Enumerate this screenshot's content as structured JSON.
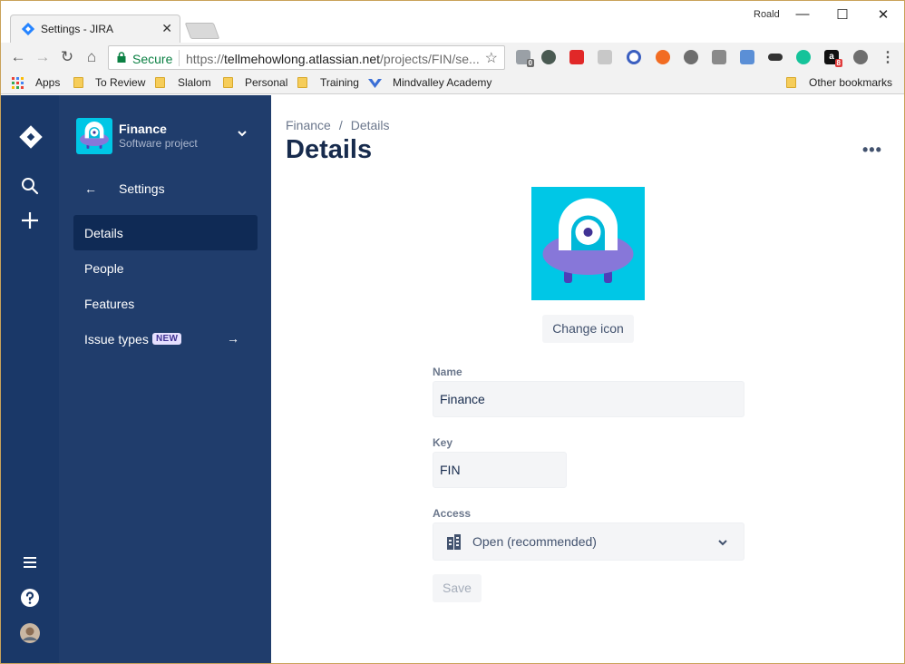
{
  "browser": {
    "tab_title": "Settings - JIRA",
    "tab_close": "✕",
    "profile_name": "Roald",
    "window_controls": {
      "minimize": "—",
      "maximize": "☐",
      "close": "✕"
    },
    "nav": {
      "back": "←",
      "forward": "→",
      "reload": "↻",
      "home": "⌂"
    },
    "secure_label": "Secure",
    "url_scheme": "https://",
    "url_host": "tellmehowlong.atlassian.net",
    "url_path": "/projects/FIN/se...",
    "star": "☆",
    "menu": "⋮",
    "extensions": [
      {
        "icon": "extension-icon",
        "color": "#9aa0a6"
      },
      {
        "icon": "evernote-icon",
        "color": "#4a5a52"
      },
      {
        "icon": "flipboard-icon",
        "color": "#e12828"
      },
      {
        "icon": "pdf-icon",
        "color": "#c8c8c8"
      },
      {
        "icon": "c-icon",
        "color": "#3b5fc0"
      },
      {
        "icon": "orange-x-icon",
        "color": "#f26c22"
      },
      {
        "icon": "gear-cluster-icon",
        "color": "#6e6e6e"
      },
      {
        "icon": "square-app-icon",
        "color": "#8a8a8a"
      },
      {
        "icon": "screen-icon",
        "color": "#5b8fd6"
      },
      {
        "icon": "mask-icon",
        "color": "#333333"
      },
      {
        "icon": "grammarly-icon",
        "color": "#15c39a"
      },
      {
        "icon": "amazon-icon",
        "color": "#111111"
      },
      {
        "icon": "sync-icon",
        "color": "#6e6e6e"
      }
    ],
    "extension_badges": {
      "first": "0",
      "amazon": "8"
    },
    "amazon_glyph": "a",
    "bookmarks": {
      "apps": "Apps",
      "to_review": "To Review",
      "slalom": "Slalom",
      "personal": "Personal",
      "training": "Training",
      "mindvalley": "Mindvalley Academy",
      "other": "Other bookmarks"
    }
  },
  "global_nav": {
    "items": [
      "jira-logo-icon",
      "search-icon",
      "create-plus-icon",
      "menu-icon",
      "help-icon",
      "user-avatar"
    ]
  },
  "sidebar": {
    "project_name": "Finance",
    "project_type": "Software project",
    "back_arrow": "←",
    "settings_label": "Settings",
    "items": [
      {
        "label": "Details",
        "active": true
      },
      {
        "label": "People",
        "active": false
      },
      {
        "label": "Features",
        "active": false
      },
      {
        "label": "Issue types",
        "active": false,
        "badge": "NEW",
        "trailing": "→"
      }
    ]
  },
  "main": {
    "breadcrumb": {
      "parent": "Finance",
      "separator": "/",
      "current": "Details"
    },
    "title": "Details",
    "more": "•••",
    "change_icon_label": "Change icon",
    "fields": {
      "name_label": "Name",
      "name_value": "Finance",
      "key_label": "Key",
      "key_value": "FIN",
      "access_label": "Access",
      "access_value": "Open (recommended)"
    },
    "save_label": "Save"
  },
  "colors": {
    "global_nav_bg": "#1a3868",
    "sidebar_bg": "#203d6c",
    "active_item_bg": "#0f2a55",
    "avatar_bg": "#00c7e6",
    "title_text": "#172b4d",
    "field_bg": "#f4f5f7",
    "secure_green": "#0b8043"
  }
}
